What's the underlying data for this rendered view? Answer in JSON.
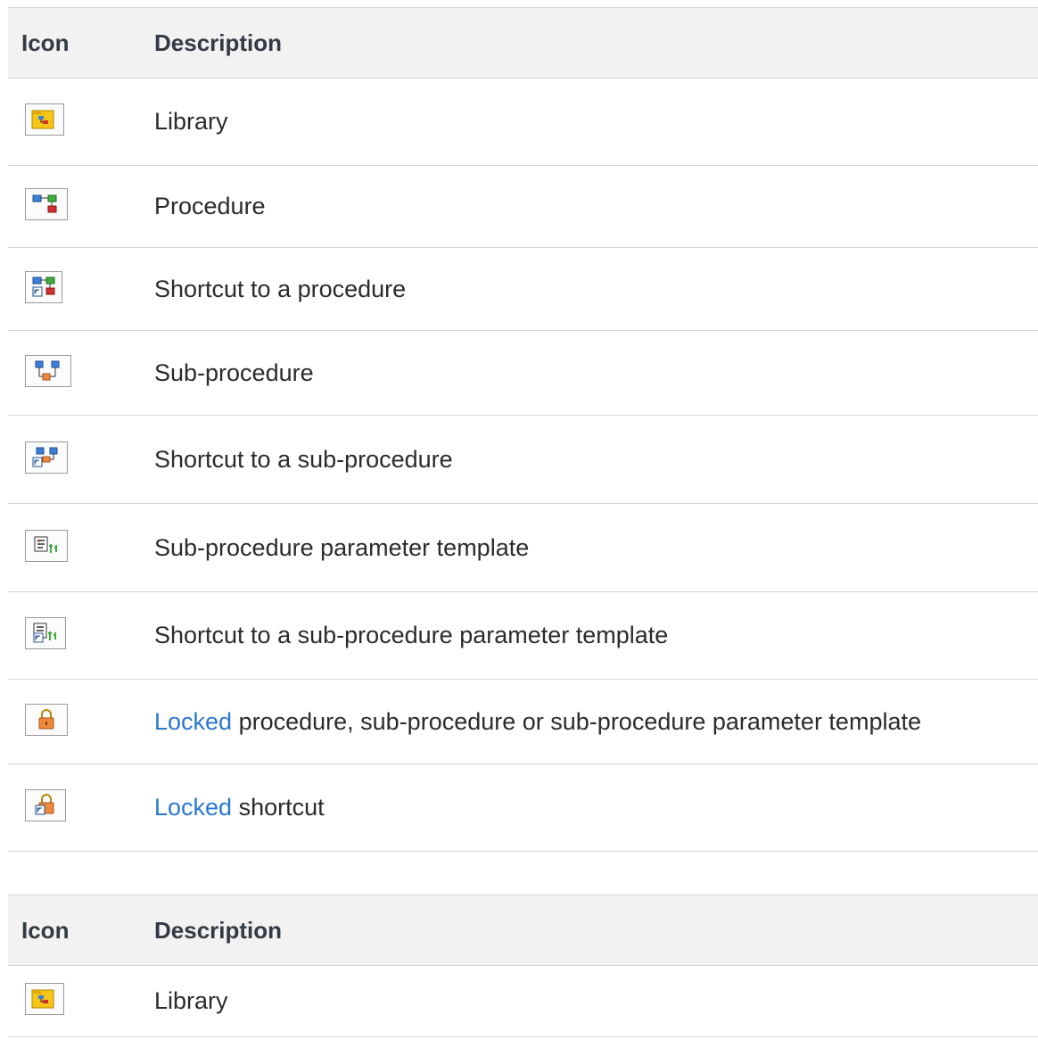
{
  "table1": {
    "header": {
      "icon": "Icon",
      "description": "Description"
    },
    "rows": [
      {
        "icon": "library-icon",
        "text": "Library"
      },
      {
        "icon": "procedure-icon",
        "text": "Procedure"
      },
      {
        "icon": "procedure-shortcut-icon",
        "text": "Shortcut to a procedure"
      },
      {
        "icon": "sub-procedure-icon",
        "text": "Sub-procedure"
      },
      {
        "icon": "sub-procedure-shortcut-icon",
        "text": "Shortcut to a sub-procedure"
      },
      {
        "icon": "parameter-template-icon",
        "text": "Sub-procedure parameter template"
      },
      {
        "icon": "parameter-template-shortcut-icon",
        "text": "Shortcut to a sub-procedure parameter template"
      },
      {
        "icon": "locked-icon",
        "link": "Locked",
        "text": " procedure, sub-procedure or sub-procedure parameter template"
      },
      {
        "icon": "locked-shortcut-icon",
        "link": "Locked",
        "text": " shortcut"
      }
    ]
  },
  "table2": {
    "header": {
      "icon": "Icon",
      "description": "Description"
    },
    "rows": [
      {
        "icon": "library-icon",
        "text": "Library"
      }
    ]
  },
  "colors": {
    "link": "#2a77d0",
    "header_bg": "#f2f2f2",
    "border": "#d6d6d6"
  }
}
